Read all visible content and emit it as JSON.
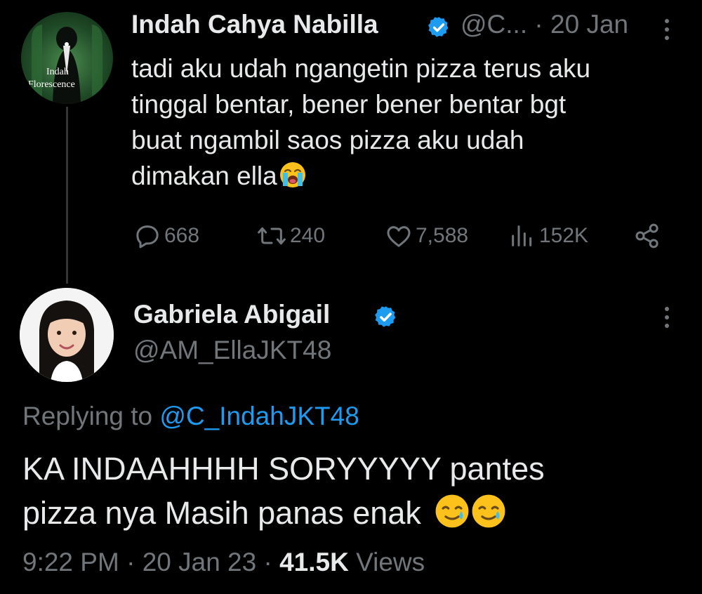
{
  "parent_tweet": {
    "author_name": "Indah Cahya Nabilla",
    "handle": "@C...",
    "separator": "·",
    "date": "20 Jan",
    "avatar_text_line1": "Indah",
    "avatar_text_line2": "Florescence",
    "text_lines": [
      "tadi aku udah ngangetin pizza terus aku",
      "tinggal bentar, bener bener bentar bgt",
      "buat ngambil saos pizza aku udah",
      "dimakan ella"
    ],
    "replies": "668",
    "reposts": "240",
    "likes": "7,588",
    "views": "152K"
  },
  "reply_tweet": {
    "author_name": "Gabriela Abigail",
    "handle": "@AM_EllaJKT48",
    "replying_prefix": "Replying to",
    "replying_to": "@C_IndahJKT48",
    "text_lines": [
      "KA INDAAHHHH SORYYYYY pantes",
      "pizza nya Masih panas enak"
    ],
    "time": "9:22 PM",
    "separator": "·",
    "date": "20 Jan 23",
    "views_count": "41.5K",
    "views_label": "Views"
  },
  "colors": {
    "background": "#000000",
    "text": "#e7e9ea",
    "secondary": "#71767b",
    "accent": "#1d9bf0"
  },
  "icons": [
    "verified-badge-icon",
    "more-options-icon",
    "reply-icon",
    "repost-icon",
    "like-icon",
    "views-icon",
    "share-icon",
    "loudly-crying-face-emoji",
    "smiling-face-with-tear-emoji"
  ]
}
